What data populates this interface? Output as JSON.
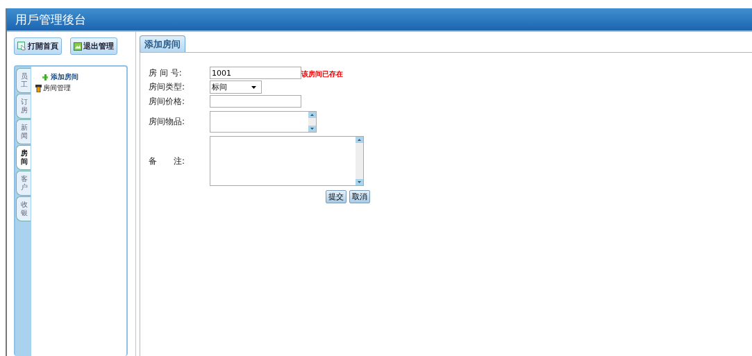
{
  "header": {
    "title": "用戶管理後台"
  },
  "toolbar": {
    "buttons": [
      {
        "label": "打開首頁",
        "kind": "home"
      },
      {
        "label": "退出管理",
        "kind": "exit"
      }
    ]
  },
  "sidebar": {
    "tabs": [
      {
        "label": "员工",
        "selected": false
      },
      {
        "label": "订房",
        "selected": false
      },
      {
        "label": "新闻",
        "selected": false
      },
      {
        "label": "房间",
        "selected": true
      },
      {
        "label": "客户",
        "selected": false
      },
      {
        "label": "收银",
        "selected": false
      }
    ],
    "items": [
      {
        "label": "添加房间",
        "selected": true,
        "kind": "add"
      },
      {
        "label": "房间管理",
        "selected": false,
        "kind": "manage"
      }
    ]
  },
  "main_tab": {
    "label": "添加房间"
  },
  "form": {
    "fields": [
      {
        "label": "房 间 号:",
        "kind": "text",
        "value": "1001",
        "error": "该房间已存在"
      },
      {
        "label": "房间类型:",
        "kind": "select",
        "value": "标间"
      },
      {
        "label": "房间价格:",
        "kind": "text"
      },
      {
        "label": "房间物品:",
        "kind": "textarea_small"
      },
      {
        "label": "备　　注:",
        "kind": "textarea_large"
      }
    ],
    "buttons": [
      "提交",
      "取消"
    ]
  }
}
